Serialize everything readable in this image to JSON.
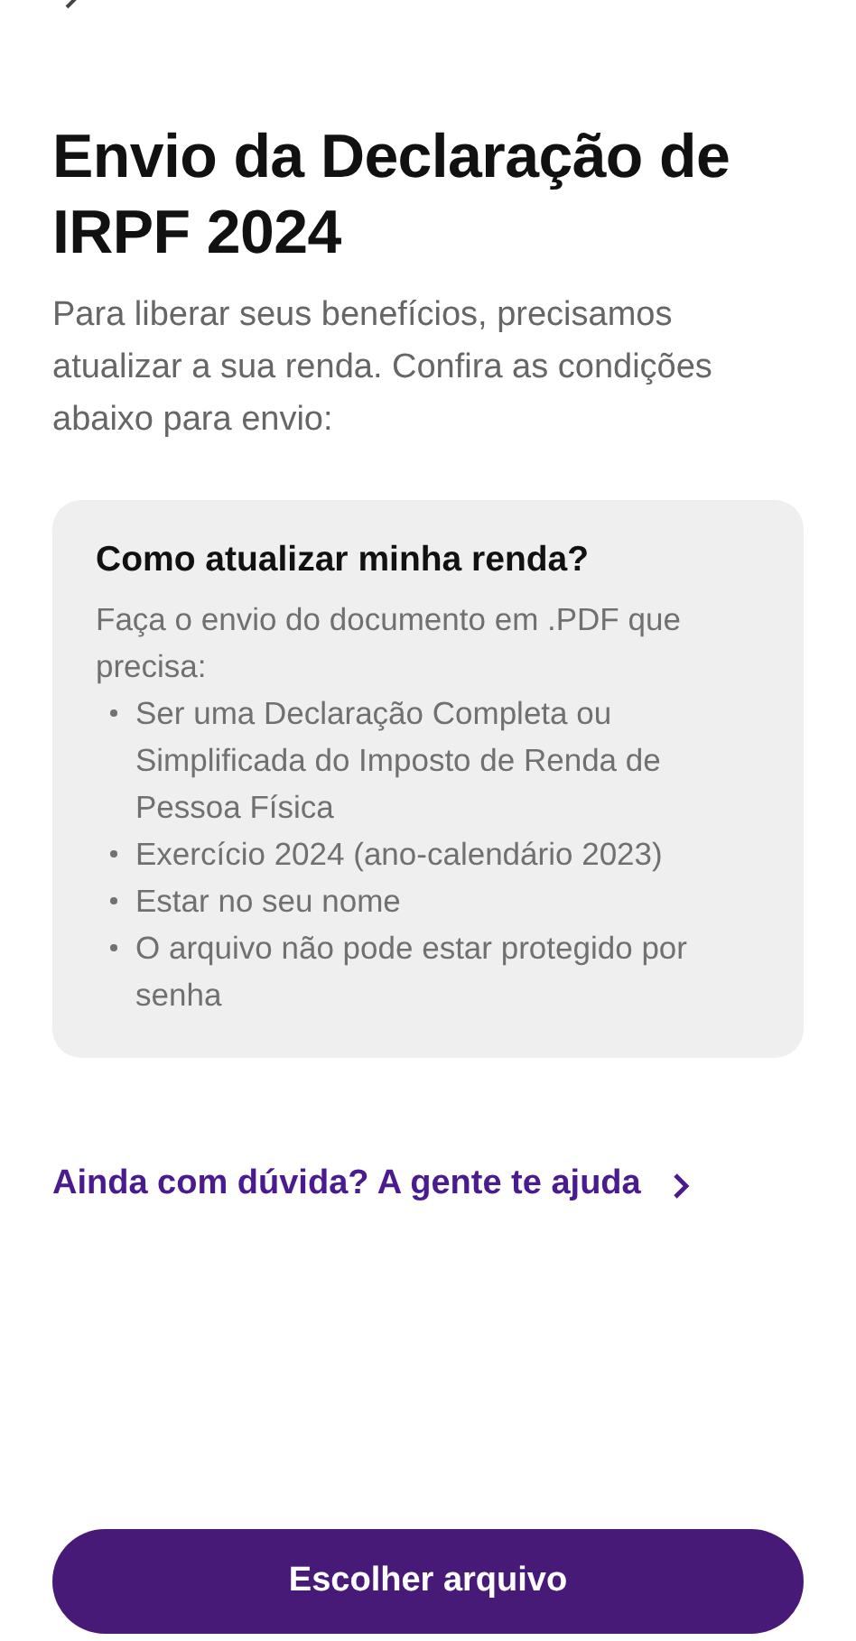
{
  "title": "Envio da Declaração de IRPF 2024",
  "intro": "Para liberar seus benefícios, precisamos atualizar a sua renda. Confira as condições abaixo para envio:",
  "info_card": {
    "title": "Como atualizar minha renda?",
    "text": "Faça o envio do documento em .PDF que precisa:",
    "items": [
      "Ser uma Declaração Completa ou Simplificada do Imposto de Renda de Pessoa Física",
      "Exercício 2024 (ano-calendário 2023)",
      "Estar no seu nome",
      "O arquivo não pode estar protegido por senha"
    ]
  },
  "help_link": "Ainda com dúvida? A gente te ajuda",
  "primary_button": "Escolher arquivo"
}
